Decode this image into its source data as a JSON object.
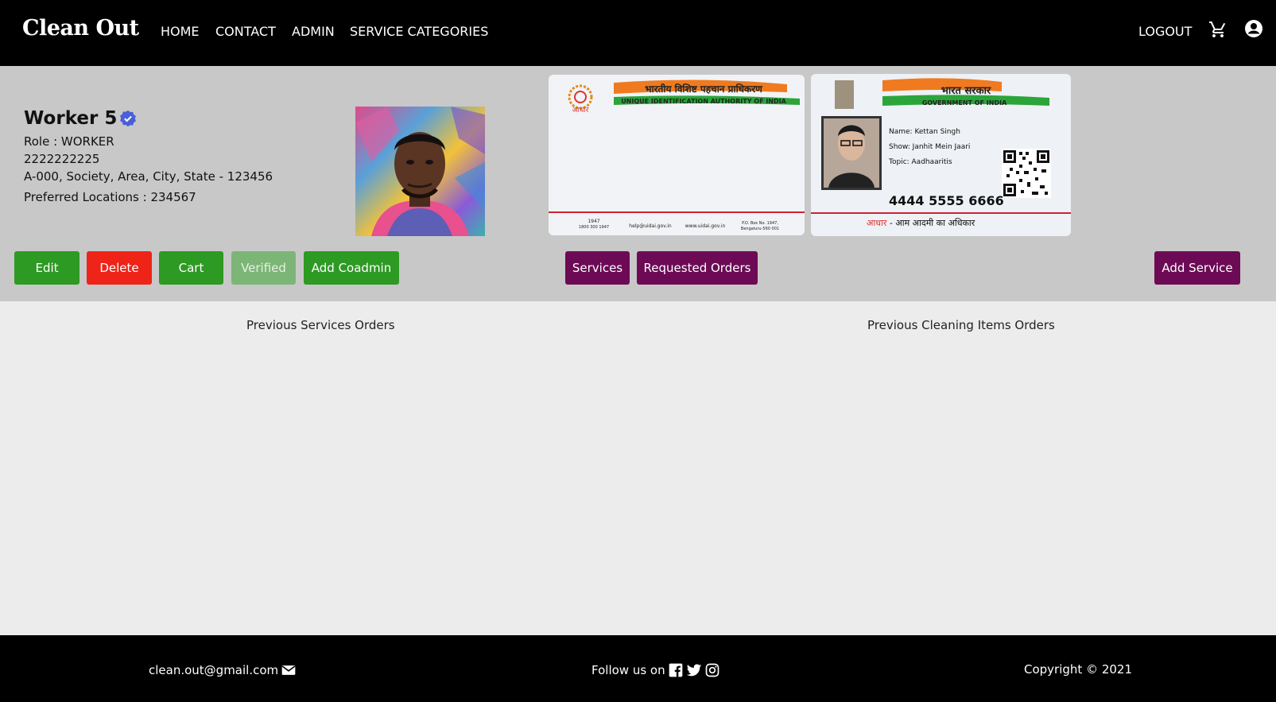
{
  "navbar": {
    "brand": "Clean Out",
    "links": [
      "HOME",
      "CONTACT",
      "ADMIN",
      "SERVICE CATEGORIES"
    ],
    "logout": "LOGOUT",
    "icons": [
      "cart-icon",
      "account-icon"
    ]
  },
  "profile": {
    "name": "Worker 5",
    "role": "Role : WORKER",
    "phone": "2222222225",
    "address": "A-000, Society, Area, City, State - 123456",
    "preferred_locations": "Preferred Locations : 234567",
    "verified_badge_color": "#4a5fd8"
  },
  "id_card_back": {
    "title_hi": "भारतीय विशिष्ट पहचान प्राधिकरण",
    "title_en": "UNIQUE IDENTIFICATION AUTHORITY OF INDIA",
    "logo_text": "आधार",
    "phone": "1947",
    "phone_alt": "1800 300 1947",
    "email": "help@uidai.gov.in",
    "web": "www.uidai.gov.in",
    "pobox_1": "P.O. Box No. 1947,",
    "pobox_2": "Bengaluru-560 001"
  },
  "id_card_front": {
    "title_hi": "भारत सरकार",
    "title_en": "GOVERNMENT OF INDIA",
    "name": "Name: Kettan Singh",
    "show": "Show: Janhit Mein Jaari",
    "topic": "Topic: Aadhaaritis",
    "number": "4444  5555  6666",
    "footer_hi_a": "आधार",
    "footer_hi_b": " - आम आदमी का अधिकार"
  },
  "buttons": {
    "edit": "Edit",
    "delete": "Delete",
    "cart": "Cart",
    "verified": "Verified",
    "add_coadmin": "Add Coadmin",
    "services": "Services",
    "requested_orders": "Requested Orders",
    "add_service": "Add Service"
  },
  "main": {
    "previous_services": "Previous Services Orders",
    "previous_items": "Previous Cleaning Items Orders"
  },
  "footer": {
    "email": "clean.out@gmail.com",
    "follow": "Follow us on",
    "copyright": "Copyright © 2021",
    "social_icons": [
      "facebook-icon",
      "twitter-icon",
      "instagram-icon"
    ]
  },
  "colors": {
    "nav_bg": "#000000",
    "profile_bg": "#c8c8c8",
    "green": "#2d9a23",
    "red": "#ee2418",
    "purple": "#6d0a55"
  }
}
